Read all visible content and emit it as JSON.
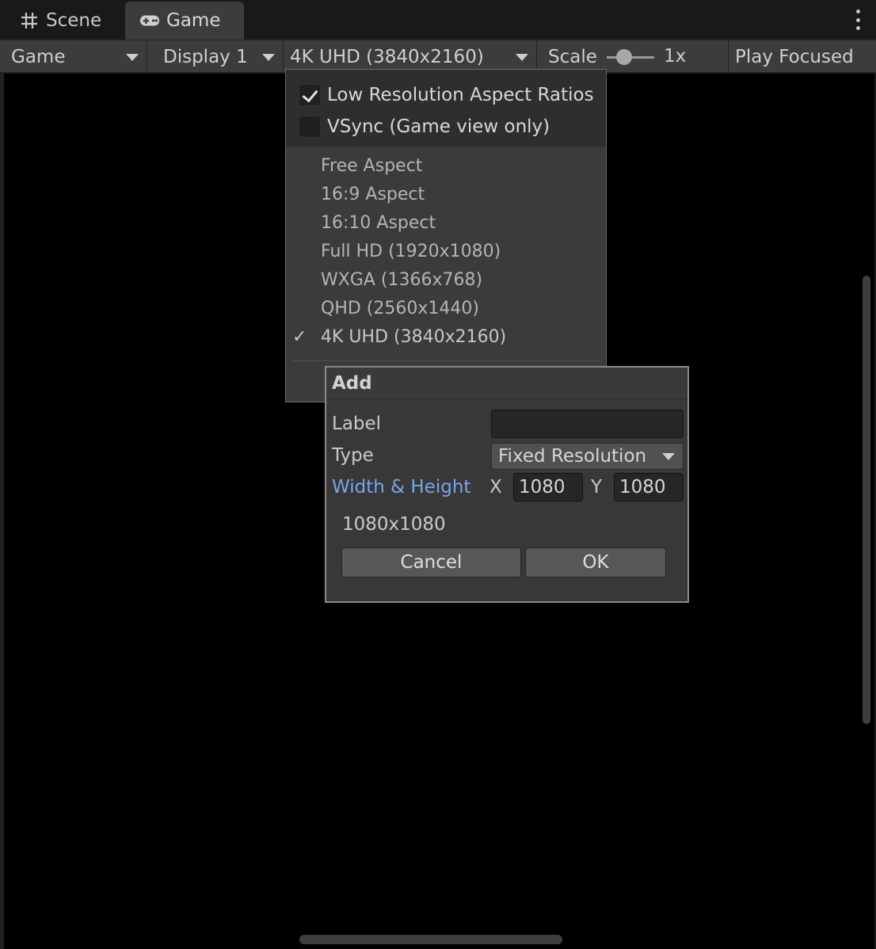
{
  "tabs": [
    {
      "label": "Scene",
      "icon": "grid-icon"
    },
    {
      "label": "Game",
      "icon": "gamepad-icon",
      "active": true
    }
  ],
  "toolbar": {
    "game_label": "Game",
    "display_label": "Display 1",
    "resolution_label": "4K UHD (3840x2160)",
    "scale_label": "Scale",
    "scale_value": "1x",
    "play_label": "Play Focused"
  },
  "menu": {
    "low_res_label": "Low Resolution Aspect Ratios",
    "low_res_checked": true,
    "vsync_label": "VSync (Game view only)",
    "vsync_checked": false,
    "items": [
      "Free Aspect",
      "16:9 Aspect",
      "16:10 Aspect",
      "Full HD (1920x1080)",
      "WXGA (1366x768)",
      "QHD (2560x1440)",
      "4K UHD (3840x2160)"
    ],
    "selected_index": 6,
    "tick_glyph": "✓"
  },
  "dialog": {
    "title": "Add",
    "label_label": "Label",
    "label_value": "",
    "type_label": "Type",
    "type_value": "Fixed Resolution",
    "wh_label": "Width & Height",
    "x_label": "X",
    "x_value": "1080",
    "y_label": "Y",
    "y_value": "1080",
    "preview": "1080x1080",
    "cancel_label": "Cancel",
    "ok_label": "OK"
  },
  "colors": {
    "accent_link": "#7ba4ec",
    "background": "#000000",
    "panel": "#3c3c3c"
  }
}
